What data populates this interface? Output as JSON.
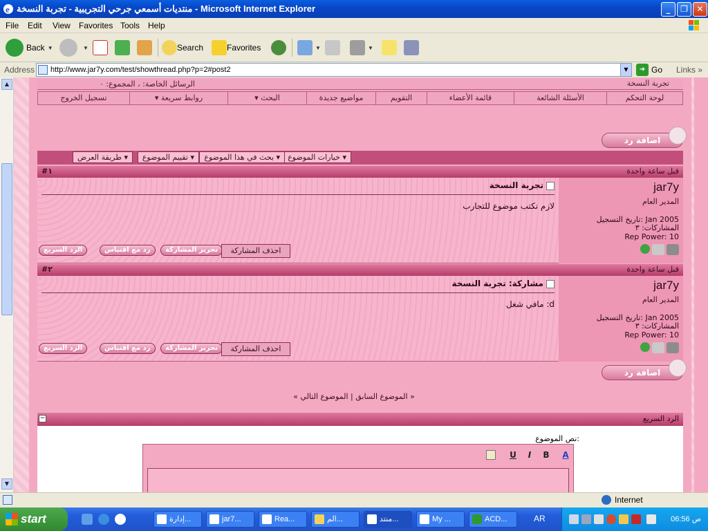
{
  "window": {
    "title": "منتديات أسمعي جرحي التجريبية - تجربة النسخة - Microsoft Internet Explorer",
    "minimize": "_",
    "maximize": "❐",
    "close": "✕"
  },
  "menu": [
    "File",
    "Edit",
    "View",
    "Favorites",
    "Tools",
    "Help"
  ],
  "toolbar": {
    "back": "Back",
    "search": "Search",
    "favorites": "Favorites"
  },
  "address": {
    "label": "Address",
    "url": "http://www.jar7y.com/test/showthread.php?p=2#post2",
    "go": "Go",
    "links": "Links"
  },
  "forum": {
    "pm_text": "الرسائل الخاصة: ، المجموع: ٠",
    "thread_title_top": "تجربة النسخة",
    "nav": [
      "لوحة التحكم",
      "الأسئلة الشائعة",
      "قائمة الأعضاء",
      "التقويم",
      "مواضيع جديدة",
      "البحث ▾",
      "روابط سريعة ▾",
      "تسجيل الخروج"
    ],
    "reply_button": "اضافة رد",
    "thread_tools": [
      "خيارات الموضوع ▾",
      "بحث في هذا الموضوع ▾",
      "تقييم الموضوع ▾",
      "طريقة العرض ▾"
    ],
    "posts": [
      {
        "num": "#١",
        "time": "قبل ساعة واحدة",
        "username": "jar7y",
        "rank": "المدير العام",
        "join": "تاريخ التسجيل: Jan 2005",
        "posts_count": "المشاركات: ٣",
        "rep": "Rep Power: 10",
        "title": "تجربة النسخة",
        "text": "لازم نكتب موضوع للتجارب",
        "btn_quick": "الرد السريع",
        "btn_quote": "رد مع اقتباس",
        "btn_edit": "تحرير المشاركة",
        "btn_delete": "احذف المشاركة"
      },
      {
        "num": "#٢",
        "time": "قبل ساعة واحدة",
        "username": "jar7y",
        "rank": "المدير العام",
        "join": "تاريخ التسجيل: Jan 2005",
        "posts_count": "المشاركات: ٣",
        "rep": "Rep Power: 10",
        "title": "مشاركة: تجربة النسخة",
        "text": "مافي شغل :d",
        "btn_quick": "الرد السريع",
        "btn_quote": "رد مع اقتباس",
        "btn_edit": "تحرير المشاركة",
        "btn_delete": "احذف المشاركة"
      }
    ],
    "thread_nav": "« الموضوع السابق | الموضوع التالي »",
    "quick_reply_title": "الرد السريع",
    "message_label": "نص الموضوع:",
    "editor_tools": [
      "U",
      "I",
      "B",
      "A"
    ]
  },
  "status": {
    "zone": "Internet"
  },
  "taskbar": {
    "start": "start",
    "tasks": [
      "إدارة...",
      "jar7...",
      "Rea...",
      "الم...",
      "منتد...",
      "My ...",
      "ACD..."
    ],
    "lang": "AR",
    "clock": "06:56 ص"
  }
}
